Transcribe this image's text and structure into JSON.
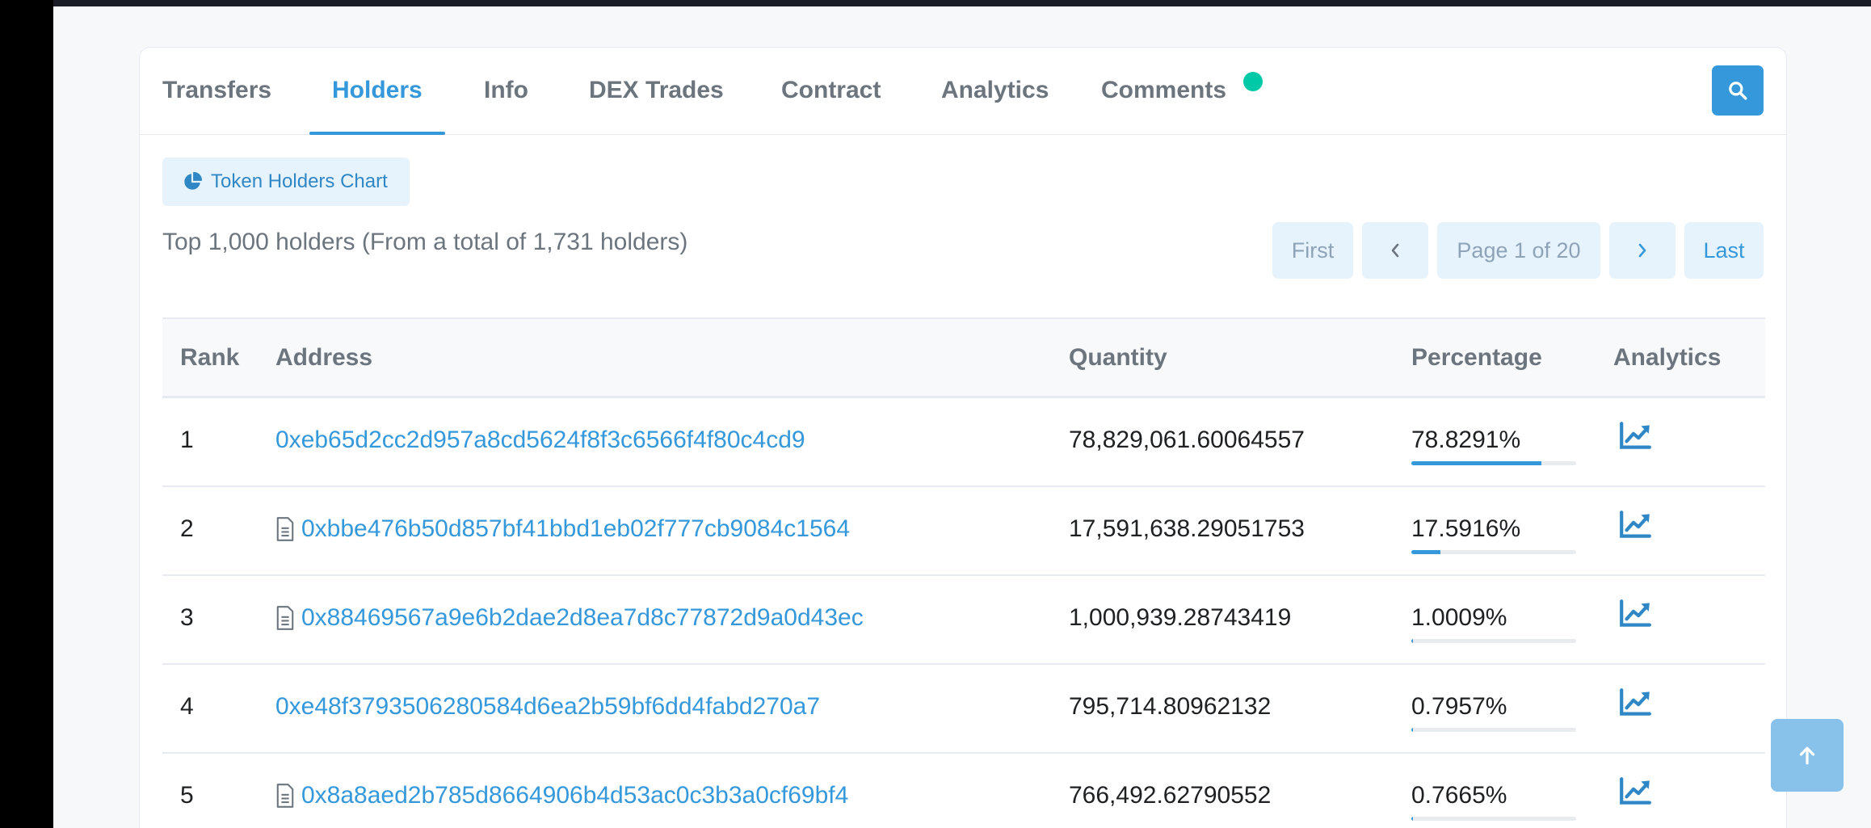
{
  "tabs": [
    {
      "label": "Transfers",
      "active": false
    },
    {
      "label": "Holders",
      "active": true
    },
    {
      "label": "Info",
      "active": false
    },
    {
      "label": "DEX Trades",
      "active": false
    },
    {
      "label": "Contract",
      "active": false
    },
    {
      "label": "Analytics",
      "active": false
    },
    {
      "label": "Comments",
      "active": false
    }
  ],
  "chart_button": {
    "label": "Token Holders Chart",
    "icon": "pie-chart-icon"
  },
  "summary": "Top 1,000 holders (From a total of 1,731 holders)",
  "pagination": {
    "first": "First",
    "page": "Page 1 of 20",
    "last": "Last"
  },
  "table": {
    "headers": [
      "Rank",
      "Address",
      "Quantity",
      "Percentage",
      "Analytics"
    ],
    "rows": [
      {
        "rank": "1",
        "address": "0xeb65d2cc2d957a8cd5624f8f3c6566f4f80c4cd9",
        "is_contract": false,
        "quantity": "78,829,061.60064557",
        "percentage": "78.8291%",
        "share": 78.8291
      },
      {
        "rank": "2",
        "address": "0xbbe476b50d857bf41bbd1eb02f777cb9084c1564",
        "is_contract": true,
        "quantity": "17,591,638.29051753",
        "percentage": "17.5916%",
        "share": 17.5916
      },
      {
        "rank": "3",
        "address": "0x88469567a9e6b2dae2d8ea7d8c77872d9a0d43ec",
        "is_contract": true,
        "quantity": "1,000,939.28743419",
        "percentage": "1.0009%",
        "share": 1.0009
      },
      {
        "rank": "4",
        "address": "0xe48f3793506280584d6ea2b59bf6dd4fabd270a7",
        "is_contract": false,
        "quantity": "795,714.80962132",
        "percentage": "0.7957%",
        "share": 0.7957
      },
      {
        "rank": "5",
        "address": "0x8a8aed2b785d8664906b4d53ac0c3b3a0cf69bf4",
        "is_contract": true,
        "quantity": "766,492.62790552",
        "percentage": "0.7665%",
        "share": 0.7665
      }
    ]
  },
  "colors": {
    "accent": "#3498db",
    "notification_dot": "#00c9a7",
    "muted": "#6c757e"
  }
}
